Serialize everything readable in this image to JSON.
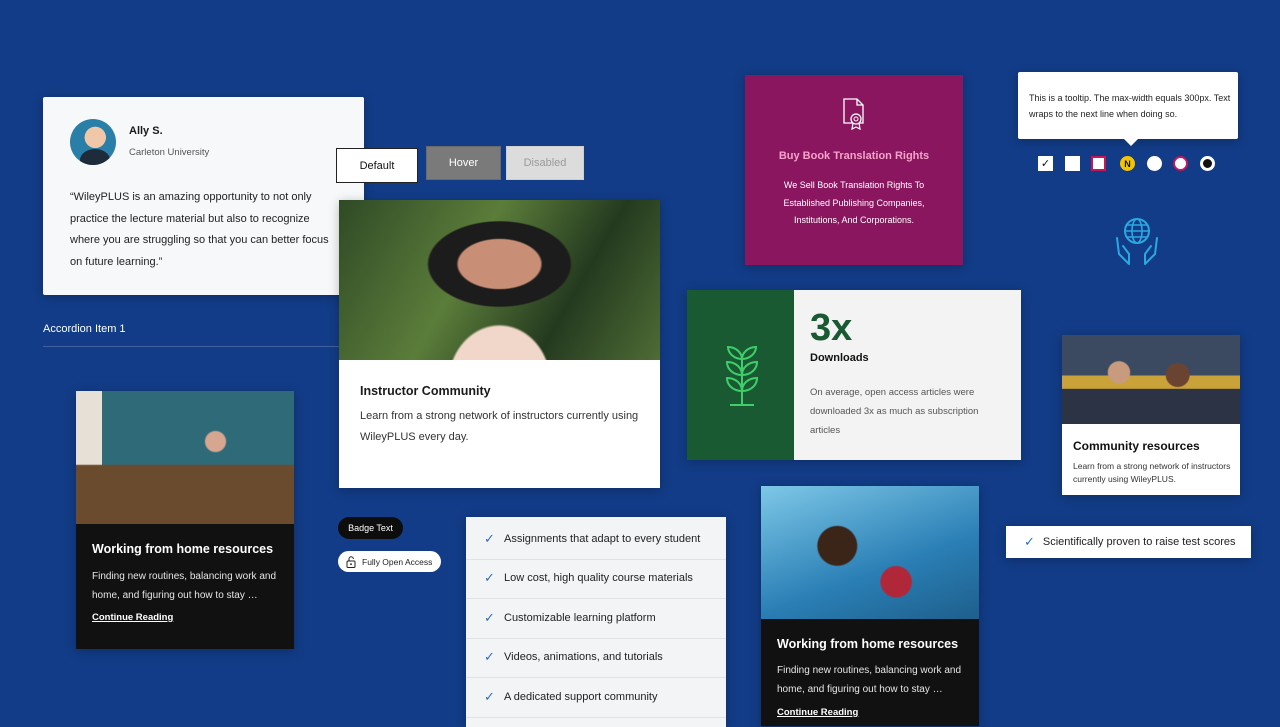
{
  "testimonial": {
    "name": "Ally S.",
    "school": "Carleton University",
    "quote": "“WileyPLUS is an amazing opportunity to not only practice the lecture material but also to recognize where you are struggling so that you can better focus on future learning.”"
  },
  "buttons": {
    "default": "Default",
    "hover": "Hover",
    "disabled": "Disabled"
  },
  "accordion": {
    "label": "Accordion Item 1",
    "icon": "plus-icon"
  },
  "instructor_card": {
    "title": "Instructor Community",
    "body": "Learn from a strong network of instructors currently using WileyPLUS every day."
  },
  "home_card_1": {
    "title": "Working from home resources",
    "body": "Finding new routines, balancing work and home, and figuring out how to stay …",
    "link": "Continue Reading"
  },
  "badges": {
    "text": "Badge Text",
    "open_access": "Fully Open Access"
  },
  "checklist": {
    "items": [
      "Assignments that adapt to every student",
      "Low cost, high quality course materials",
      "Customizable learning platform",
      "Videos, animations, and tutorials",
      "A dedicated support community"
    ]
  },
  "buy_card": {
    "title": "Buy Book Translation Rights",
    "body": "We Sell Book Translation Rights To Established Publishing Companies, Institutions, And  Corporations.",
    "accent": "#8b1660"
  },
  "stat_card": {
    "value": "3x",
    "label": "Downloads",
    "body": "On average, open access articles were downloaded 3x as much as subscription articles",
    "accent": "#1a5a33"
  },
  "tooltip": {
    "text": "This is a tooltip. The max-width equals 300px. Text wraps to the next line when doing so."
  },
  "controls": {
    "nav_letter": "N"
  },
  "community_card": {
    "title": "Community resources",
    "body": "Learn from a strong network of instructors currently using WileyPLUS."
  },
  "proof_badge": {
    "text": "Scientifically proven to raise test scores"
  },
  "home_card_2": {
    "title": "Working from home resources",
    "body": "Finding new routines, balancing work and home, and figuring out how to stay …",
    "link": "Continue Reading"
  },
  "colors": {
    "background": "#123c87",
    "check": "#2f6fbf",
    "focus": "#c2185b",
    "nav_yellow": "#f5c400"
  }
}
